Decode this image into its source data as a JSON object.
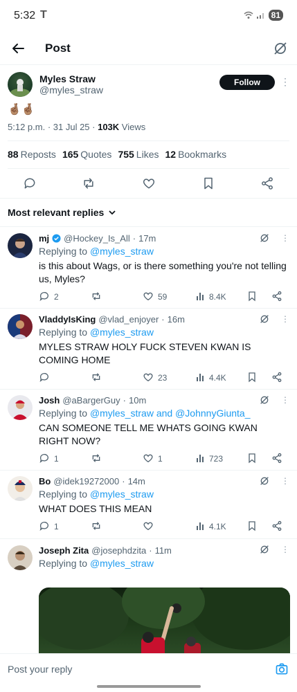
{
  "status": {
    "time": "5:32",
    "battery": "81"
  },
  "header": {
    "title": "Post"
  },
  "post": {
    "author_name": "Myles Straw",
    "author_handle": "@myles_straw",
    "follow_label": "Follow",
    "text": "🤞🏽🤞🏽",
    "time": "5:12 p.m.",
    "date": "31 Jul 25",
    "views_count": "103K",
    "views_label": "Views",
    "stats": [
      {
        "count": "88",
        "label": "Reposts"
      },
      {
        "count": "165",
        "label": "Quotes"
      },
      {
        "count": "755",
        "label": "Likes"
      },
      {
        "count": "12",
        "label": "Bookmarks"
      }
    ]
  },
  "sort": {
    "label": "Most relevant replies"
  },
  "replying_to_prefix": "Replying to",
  "replies": [
    {
      "name": "mj",
      "verified": true,
      "handle": "@Hockey_Is_All",
      "time": "17m",
      "replying_to": "@myles_straw",
      "text": "is this about Wags, or is there something you're not telling us, Myles?",
      "replies_count": "2",
      "likes": "59",
      "views": "8.4K"
    },
    {
      "name": "VladdyIsKing",
      "handle": "@vlad_enjoyer",
      "time": "16m",
      "replying_to": "@myles_straw",
      "text": "MYLES STRAW HOLY FUCK STEVEN KWAN IS COMING HOME",
      "replies_count": "",
      "likes": "23",
      "views": "4.4K"
    },
    {
      "name": "Josh",
      "handle": "@aBargerGuy",
      "time": "10m",
      "replying_to": "@myles_straw",
      "replying_and": "and",
      "replying_to_2": "@JohnnyGiunta_",
      "text": "CAN SOMEONE TELL ME WHATS GOING KWAN RIGHT NOW?",
      "replies_count": "1",
      "likes": "1",
      "views": "723"
    },
    {
      "name": "Bo",
      "handle": "@idek19272000",
      "time": "14m",
      "replying_to": "@myles_straw",
      "text": "WHAT DOES THIS MEAN",
      "replies_count": "1",
      "likes": "",
      "views": "4.1K"
    },
    {
      "name": "Joseph Zita",
      "handle": "@josephdzita",
      "time": "11m",
      "replying_to": "@myles_straw"
    }
  ],
  "composer": {
    "placeholder": "Post your reply"
  },
  "colors": {
    "accent": "#1d9bf0",
    "text": "#0f1419",
    "muted": "#536471"
  }
}
